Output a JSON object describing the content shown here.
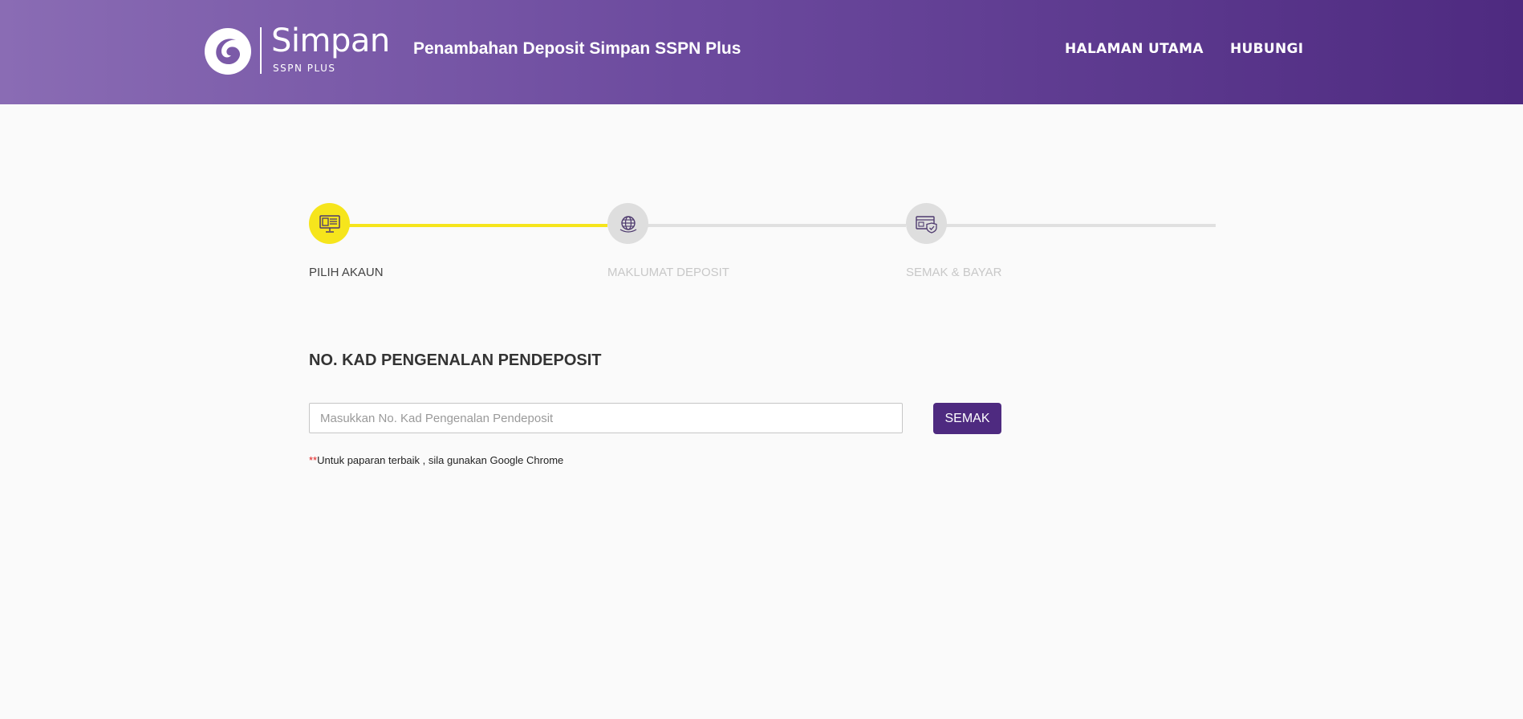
{
  "header": {
    "logo": {
      "name": "Simpan",
      "subtitle": "SSPN PLUS"
    },
    "title": "Penambahan Deposit Simpan SSPN Plus",
    "nav": {
      "home_label": "HALAMAN UTAMA",
      "contact_label": "HUBUNGI"
    }
  },
  "stepper": {
    "steps": [
      {
        "label": "PILIH AKAUN",
        "icon": "account-monitor-icon",
        "state": "active"
      },
      {
        "label": "MAKLUMAT DEPOSIT",
        "icon": "globe-icon",
        "state": "inactive"
      },
      {
        "label": "SEMAK & BAYAR",
        "icon": "secure-payment-icon",
        "state": "inactive"
      }
    ]
  },
  "form": {
    "title": "NO. KAD PENGENALAN PENDEPOSIT",
    "ic_placeholder": "Masukkan No. Kad Pengenalan Pendeposit",
    "ic_value": "",
    "check_button_label": "SEMAK",
    "note_mark": "**",
    "note_text": "Untuk paparan terbaik , sila gunakan Google Chrome"
  },
  "colors": {
    "header_gradient_start": "#8a6cb4",
    "header_gradient_end": "#4e2a80",
    "accent_yellow": "#f6e51c",
    "button_purple": "#4e2a80",
    "inactive_gray": "#dedede",
    "note_red": "#e01e1e"
  }
}
